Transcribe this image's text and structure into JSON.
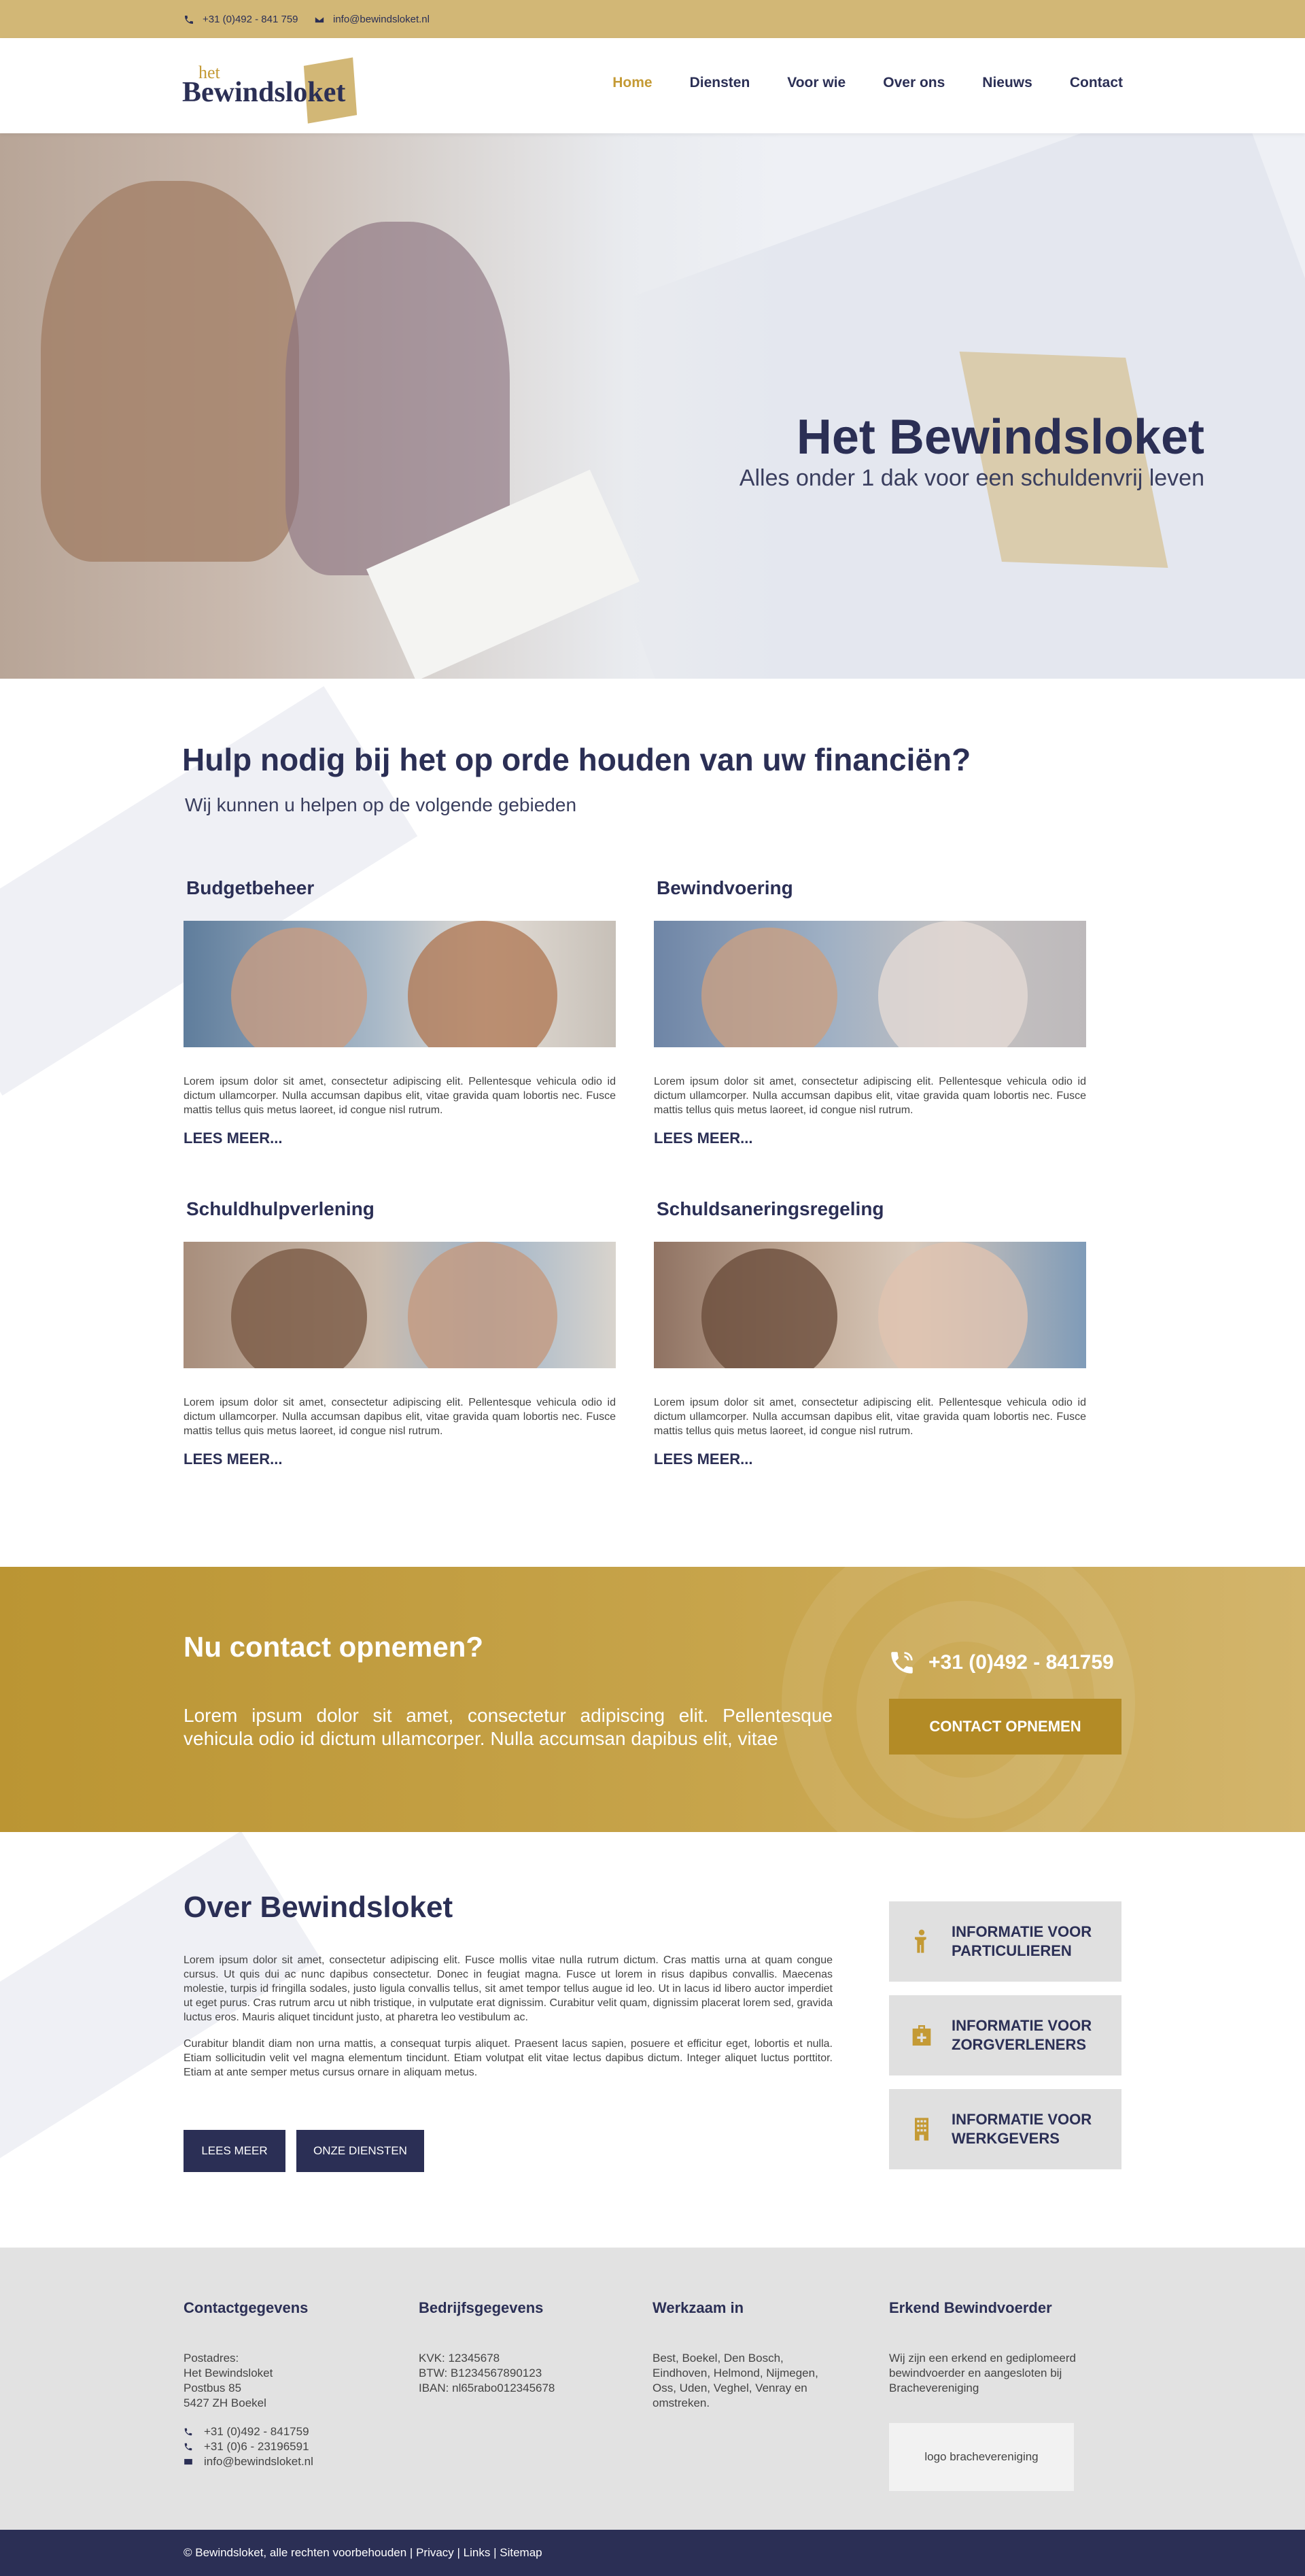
{
  "topbar": {
    "phone": "+31 (0)492 - 841 759",
    "email": "info@bewindsloket.nl"
  },
  "logo": {
    "prefix": "het",
    "name": "Bewindsloket"
  },
  "nav": [
    {
      "label": "Home",
      "active": true
    },
    {
      "label": "Diensten"
    },
    {
      "label": "Voor wie"
    },
    {
      "label": "Over ons"
    },
    {
      "label": "Nieuws"
    },
    {
      "label": "Contact"
    }
  ],
  "hero": {
    "title": "Het Bewindsloket",
    "tagline": "Alles onder 1 dak voor een schuldenvrij leven"
  },
  "services": {
    "title": "Hulp nodig bij het op orde houden van uw financiën?",
    "subtitle": "Wij kunnen u helpen op de volgende gebieden",
    "items": [
      {
        "title": "Budgetbeheer",
        "text": "Lorem ipsum dolor sit amet, consectetur adipiscing elit. Pellentesque vehicula odio id dictum ullamcorper. Nulla accumsan dapibus elit, vitae gravida quam lobortis nec. Fusce mattis tellus quis metus laoreet, id congue nisl rutrum.",
        "more": "LEES MEER..."
      },
      {
        "title": "Bewindvoering",
        "text": "Lorem ipsum dolor sit amet, consectetur adipiscing elit. Pellentesque vehicula odio id dictum ullamcorper. Nulla accumsan dapibus elit, vitae gravida quam lobortis nec. Fusce mattis tellus quis metus laoreet, id congue nisl rutrum.",
        "more": "LEES MEER..."
      },
      {
        "title": "Schuldhulpverlening",
        "text": "Lorem ipsum dolor sit amet, consectetur adipiscing elit. Pellentesque vehicula odio id dictum ullamcorper. Nulla accumsan dapibus elit, vitae gravida quam lobortis nec. Fusce mattis tellus quis metus laoreet, id congue nisl rutrum.",
        "more": "LEES MEER..."
      },
      {
        "title": "Schuldsaneringsregeling",
        "text": "Lorem ipsum dolor sit amet, consectetur adipiscing elit. Pellentesque vehicula odio id dictum ullamcorper. Nulla accumsan dapibus elit, vitae gravida quam lobortis nec. Fusce mattis tellus quis metus laoreet, id congue nisl rutrum.",
        "more": "LEES MEER..."
      }
    ]
  },
  "contact": {
    "title": "Nu contact opnemen?",
    "text": "Lorem ipsum dolor sit amet, consectetur adipiscing elit. Pellentesque vehicula odio id dictum ullamcorper. Nulla accumsan dapibus elit, vitae",
    "phone": "+31 (0)492 - 841759",
    "button": "CONTACT OPNEMEN"
  },
  "about": {
    "title": "Over Bewindsloket",
    "paragraph1": "Lorem ipsum dolor sit amet, consectetur adipiscing elit. Fusce mollis vitae nulla rutrum dictum. Cras mattis urna at quam congue cursus. Ut quis dui ac nunc dapibus consectetur. Donec in feugiat magna. Fusce ut lorem in risus dapibus convallis. Maecenas molestie, turpis id fringilla sodales, justo ligula convallis tellus, sit amet tempor tellus augue id leo. Ut in lacus id libero auctor imperdiet ut eget purus. Cras rutrum arcu ut nibh tristique, in vulputate erat dignissim. Curabitur velit quam, dignissim placerat lorem sed, gravida luctus eros. Mauris aliquet tincidunt justo, at pharetra leo vestibulum ac.",
    "paragraph2": "Curabitur blandit diam non urna mattis, a consequat turpis aliquet. Praesent lacus sapien, posuere et efficitur eget, lobortis et nulla. Etiam sollicitudin velit vel magna elementum tincidunt. Etiam volutpat elit vitae lectus dapibus dictum. Integer aliquet luctus porttitor. Etiam at ante semper metus cursus ornare in aliquam metus.",
    "button1": "LEES MEER",
    "button2": "ONZE DIENSTEN",
    "info": [
      {
        "label": "INFORMATIE VOOR PARTICULIEREN",
        "icon": "person-icon"
      },
      {
        "label": "INFORMATIE VOOR ZORGVERLENERS",
        "icon": "medical-case-icon"
      },
      {
        "label": "INFORMATIE VOOR WERKGEVERS",
        "icon": "building-icon"
      }
    ]
  },
  "footer": {
    "col1": {
      "title": "Contactgegevens",
      "address": [
        "Postadres:",
        "Het Bewindsloket",
        "Postbus 85",
        "5427 ZH Boekel"
      ],
      "phone1": "+31 (0)492 - 841759",
      "phone2": "+31 (0)6 - 23196591",
      "email": "info@bewindsloket.nl"
    },
    "col2": {
      "title": "Bedrijfsgegevens",
      "lines": [
        "KVK: 12345678",
        "BTW: B1234567890123",
        "IBAN: nl65rabo012345678"
      ]
    },
    "col3": {
      "title": "Werkzaam in",
      "text": "Best, Boekel, Den Bosch, Eindhoven, Helmond, Nijmegen, Oss, Uden, Veghel, Venray en omstreken."
    },
    "col4": {
      "title": "Erkend Bewindvoerder",
      "text": "Wij zijn een erkend en gediplomeerd bewindvoerder en aangesloten bij Brachevereniging",
      "logo_placeholder": "logo brachevereniging"
    }
  },
  "bottombar": {
    "copyright": "© Bewindsloket, alle rechten voorbehouden",
    "links": [
      "Privacy",
      "Links",
      "Sitemap"
    ]
  },
  "colors": {
    "navy": "#2b2f55",
    "gold": "#c49a35",
    "gold_light": "#d2b776",
    "footer_bg": "#e2e2e2"
  }
}
